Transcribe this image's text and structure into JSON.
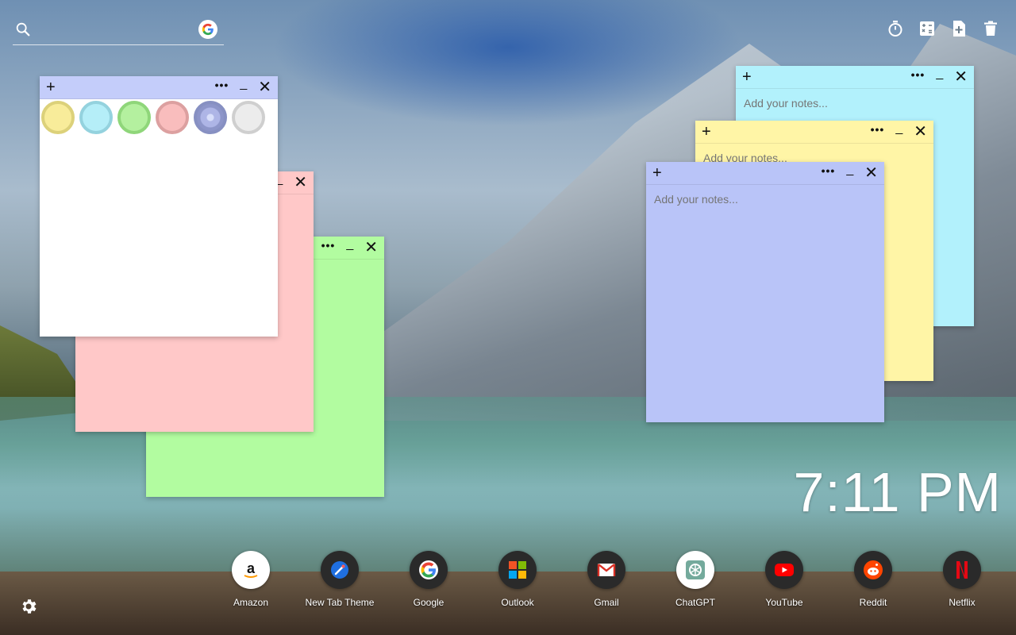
{
  "search": {
    "placeholder": ""
  },
  "toolbar": {
    "icons": [
      "stopwatch-icon",
      "calculator-icon",
      "new-note-icon",
      "trash-icon"
    ]
  },
  "notes": {
    "white": {
      "plus": "+",
      "more": "•••",
      "minimize": "_",
      "close": "✕",
      "palette": [
        "#f8ec9a",
        "#b5eef8",
        "#b4f09f",
        "#f9bdbd",
        "#aeb5e6",
        "#ececec"
      ]
    },
    "pink": {
      "close": "✕",
      "minimize": "_"
    },
    "green": {
      "more": "•••",
      "minimize": "_",
      "close": "✕"
    },
    "cyan": {
      "plus": "+",
      "more": "•••",
      "minimize": "_",
      "close": "✕",
      "placeholder": "Add your notes..."
    },
    "yellow": {
      "plus": "+",
      "more": "•••",
      "minimize": "_",
      "close": "✕",
      "placeholder": "Add your notes..."
    },
    "blue": {
      "plus": "+",
      "more": "•••",
      "minimize": "_",
      "close": "✕",
      "placeholder": "Add your notes..."
    }
  },
  "clock": {
    "time": "7:11 PM"
  },
  "dock": {
    "apps": [
      {
        "label": "Amazon",
        "icon": "amazon-icon"
      },
      {
        "label": "New Tab Theme",
        "icon": "new-tab-theme-icon"
      },
      {
        "label": "Google",
        "icon": "google-icon"
      },
      {
        "label": "Outlook",
        "icon": "outlook-icon"
      },
      {
        "label": "Gmail",
        "icon": "gmail-icon"
      },
      {
        "label": "ChatGPT",
        "icon": "chatgpt-icon"
      },
      {
        "label": "YouTube",
        "icon": "youtube-icon"
      },
      {
        "label": "Reddit",
        "icon": "reddit-icon"
      },
      {
        "label": "Netflix",
        "icon": "netflix-icon"
      }
    ]
  },
  "colors": {
    "note_white": "#ffffff",
    "note_pink": "#ffc8c8",
    "note_green": "#b2fca0",
    "note_cyan": "#b2f1fc",
    "note_yellow": "#fff5a6",
    "note_blue": "#b9c4f8",
    "bar_blue": "#c4cdfa"
  }
}
